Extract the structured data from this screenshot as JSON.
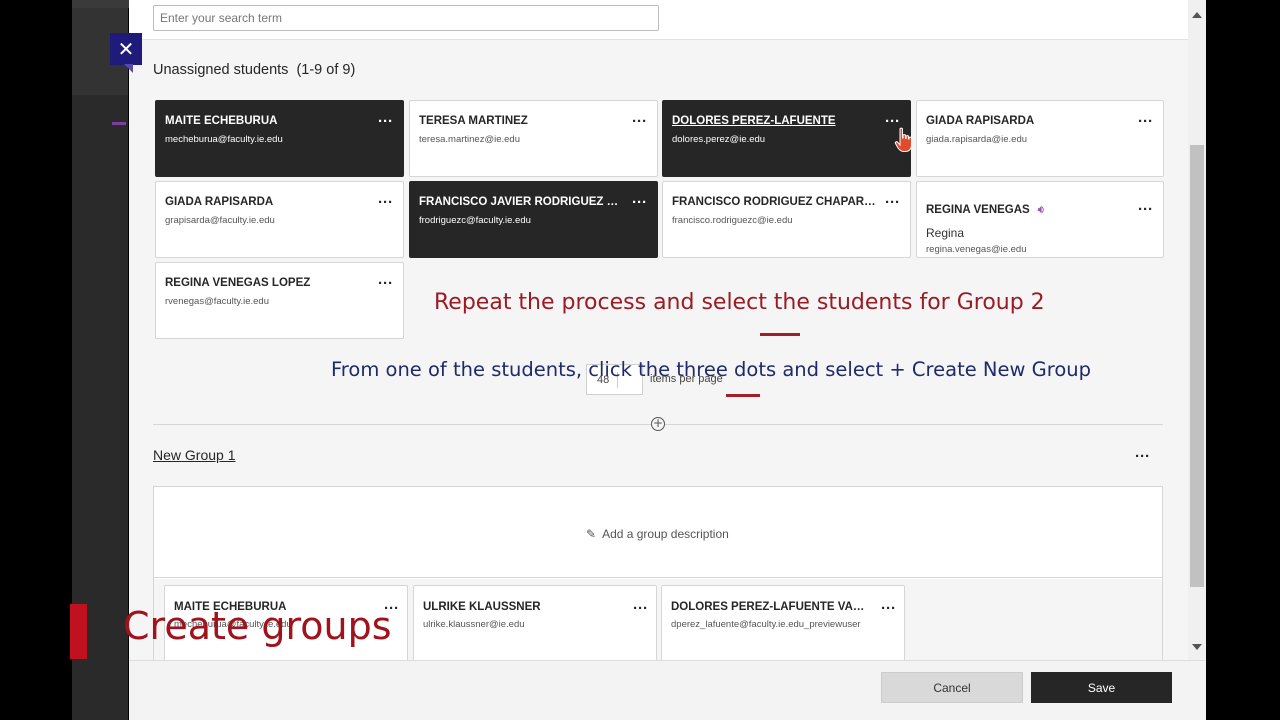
{
  "search": {
    "placeholder": "Enter your search term"
  },
  "unassigned": {
    "title": "Unassigned students",
    "count": "(1-9 of 9)",
    "students": [
      {
        "name": "MAITE ECHEBURUA",
        "email": "mecheburua@faculty.ie.edu",
        "selected": true
      },
      {
        "name": "TERESA MARTINEZ",
        "email": "teresa.martinez@ie.edu",
        "selected": false
      },
      {
        "name": "DOLORES PEREZ-LAFUENTE",
        "email": "dolores.perez@ie.edu",
        "selected": true
      },
      {
        "name": "GIADA RAPISARDA",
        "email": "giada.rapisarda@ie.edu",
        "selected": false
      },
      {
        "name": "GIADA RAPISARDA",
        "email": "grapisarda@faculty.ie.edu",
        "selected": false
      },
      {
        "name": "FRANCISCO JAVIER RODRÍGUEZ CHAPARRO",
        "email": "frodriguezc@faculty.ie.edu",
        "selected": true
      },
      {
        "name": "FRANCISCO RODRIGUEZ CHAPARRO",
        "email": "francisco.rodriguezc@ie.edu",
        "selected": false
      },
      {
        "name": "REGINA VENEGAS",
        "subname": "Regina",
        "email": "regina.venegas@ie.edu",
        "selected": false
      },
      {
        "name": "REGINA VENEGAS LOPEZ",
        "email": "rvenegas@faculty.ie.edu",
        "selected": false
      }
    ]
  },
  "pagination": {
    "per_page": "48",
    "label": "items per page"
  },
  "group": {
    "title": "New Group 1",
    "description_placeholder": "Add a group description",
    "members": [
      {
        "name": "MAITE ECHEBURUA",
        "email": "mecheburua@faculty.ie.edu"
      },
      {
        "name": "ULRIKE KLAUSSNER",
        "email": "ulrike.klaussner@ie.edu"
      },
      {
        "name": "DOLORES PEREZ-LAFUENTE VARELA-CID",
        "email": "dperez_lafuente@faculty.ie.edu_previewuser"
      }
    ]
  },
  "footer": {
    "cancel_label": "Cancel",
    "save_label": "Save"
  },
  "captions": {
    "line1": "Repeat the process and select the students for Group 2",
    "line2": "From one of the students, click the three dots and select + Create New Group",
    "watermark": "Create groups"
  },
  "icons": {
    "close": "close-icon",
    "more": "more-dots-icon",
    "speaker": "speaker-icon",
    "pencil": "pencil-icon",
    "add": "plus-circle-icon",
    "cursor": "hand-pointer-icon"
  },
  "colors": {
    "selected_card": "#262626",
    "close_button": "#1f1b7a",
    "caption_red": "#9b1b24",
    "caption_blue": "#1f2a6b",
    "watermark_red": "#a0121c"
  }
}
